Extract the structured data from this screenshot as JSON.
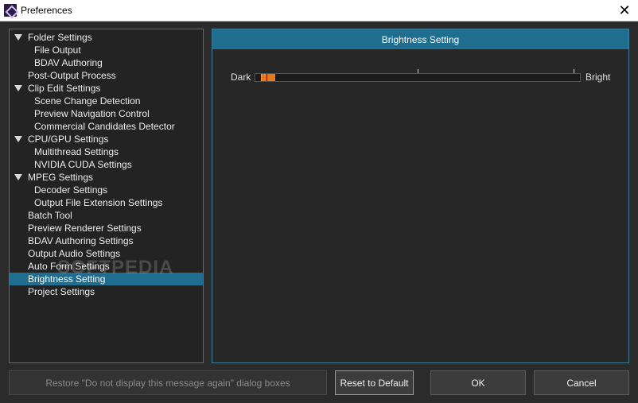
{
  "window": {
    "title": "Preferences",
    "close_glyph": "✕"
  },
  "tree": {
    "items": [
      {
        "label": "Folder Settings",
        "level": 0,
        "expanded": true
      },
      {
        "label": "File Output",
        "level": 1
      },
      {
        "label": "BDAV Authoring",
        "level": 1
      },
      {
        "label": "Post-Output Process",
        "level": 0
      },
      {
        "label": "Clip Edit Settings",
        "level": 0,
        "expanded": true
      },
      {
        "label": "Scene Change Detection",
        "level": 1
      },
      {
        "label": "Preview Navigation Control",
        "level": 1
      },
      {
        "label": "Commercial Candidates Detector",
        "level": 1
      },
      {
        "label": "CPU/GPU Settings",
        "level": 0,
        "expanded": true
      },
      {
        "label": "Multithread Settings",
        "level": 1
      },
      {
        "label": "NVIDIA CUDA Settings",
        "level": 1
      },
      {
        "label": "MPEG Settings",
        "level": 0,
        "expanded": true
      },
      {
        "label": "Decoder Settings",
        "level": 1
      },
      {
        "label": "Output File Extension Settings",
        "level": 1
      },
      {
        "label": "Batch Tool",
        "level": 0
      },
      {
        "label": "Preview Renderer Settings",
        "level": 0
      },
      {
        "label": "BDAV Authoring Settings",
        "level": 0
      },
      {
        "label": "Output Audio Settings",
        "level": 0
      },
      {
        "label": "Auto Form Settings",
        "level": 0
      },
      {
        "label": "Brightness Setting",
        "level": 0,
        "selected": true
      },
      {
        "label": "Project Settings",
        "level": 0
      }
    ]
  },
  "watermark": "SOFTPEDIA",
  "panel": {
    "title": "Brightness Setting",
    "slider": {
      "min_label": "Dark",
      "max_label": "Bright",
      "value_fraction": 0.02,
      "tick_fractions": [
        0.5,
        0.98
      ]
    }
  },
  "buttons": {
    "restore": "Restore \"Do not display this message again\" dialog boxes",
    "reset": "Reset to Default",
    "ok": "OK",
    "cancel": "Cancel"
  },
  "colors": {
    "accent": "#1f6d8f",
    "slider_thumb": "#e8771e"
  }
}
